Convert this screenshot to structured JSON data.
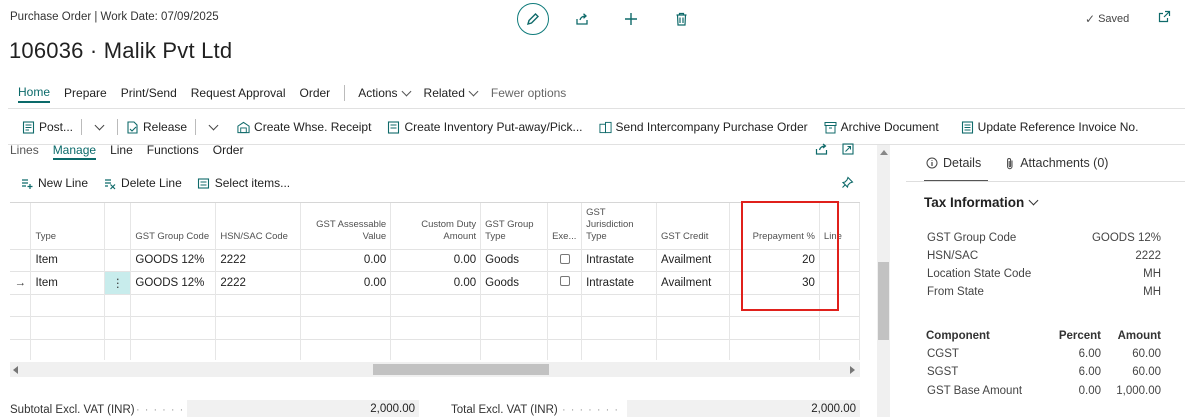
{
  "header": {
    "breadcrumb": "Purchase Order | Work Date: 07/09/2025",
    "title": "106036 · Malik Pvt Ltd",
    "saved_label": "Saved"
  },
  "actionbar": {
    "home": "Home",
    "prepare": "Prepare",
    "print_send": "Print/Send",
    "request_approval": "Request Approval",
    "order": "Order",
    "actions": "Actions",
    "related": "Related",
    "fewer_options": "Fewer options"
  },
  "commandbar": {
    "post": "Post...",
    "release": "Release",
    "create_whse_receipt": "Create Whse. Receipt",
    "create_inventory_putaway": "Create Inventory Put-away/Pick...",
    "send_intercompany": "Send Intercompany Purchase Order",
    "archive_document": "Archive Document",
    "update_reference_invoice": "Update Reference Invoice No."
  },
  "lines": {
    "label": "Lines",
    "tabs": {
      "manage": "Manage",
      "line": "Line",
      "functions": "Functions",
      "order": "Order"
    },
    "commands": {
      "new_line": "New Line",
      "delete_line": "Delete Line",
      "select_items": "Select items..."
    },
    "columns": {
      "type": "Type",
      "gst_group_code": "GST Group Code",
      "hsn_sac_code": "HSN/SAC Code",
      "gst_assessable_value": "GST Assessable Value",
      "custom_duty_amount": "Custom Duty Amount",
      "gst_group_type": "GST Group Type",
      "exempted": "Exe...",
      "gst_jurisdiction_type": "GST Jurisdiction Type",
      "gst_credit": "GST Credit",
      "prepayment_pct": "Prepayment %",
      "line": "Line"
    },
    "rows": [
      {
        "type": "Item",
        "gst_group_code": "GOODS 12%",
        "hsn_sac_code": "2222",
        "gst_assessable_value": "0.00",
        "custom_duty_amount": "0.00",
        "gst_group_type": "Goods",
        "jurisdiction": "Intrastate",
        "gst_credit": "Availment",
        "prepayment_pct": "20"
      },
      {
        "type": "Item",
        "gst_group_code": "GOODS 12%",
        "hsn_sac_code": "2222",
        "gst_assessable_value": "0.00",
        "custom_duty_amount": "0.00",
        "gst_group_type": "Goods",
        "jurisdiction": "Intrastate",
        "gst_credit": "Availment",
        "prepayment_pct": "30"
      }
    ]
  },
  "totals": {
    "subtotal_label": "Subtotal Excl. VAT (INR)",
    "subtotal_value": "2,000.00",
    "total_label": "Total Excl. VAT (INR)",
    "total_value": "2,000.00"
  },
  "factbox": {
    "tabs": {
      "details": "Details",
      "attachments": "Attachments (0)"
    },
    "section_title": "Tax Information",
    "fields": [
      {
        "label": "GST Group Code",
        "value": "GOODS 12%"
      },
      {
        "label": "HSN/SAC",
        "value": "2222"
      },
      {
        "label": "Location State Code",
        "value": "MH"
      },
      {
        "label": "From State",
        "value": "MH"
      }
    ],
    "components_header": {
      "component": "Component",
      "percent": "Percent",
      "amount": "Amount"
    },
    "components": [
      {
        "component": "CGST",
        "percent": "6.00",
        "amount": "60.00"
      },
      {
        "component": "SGST",
        "percent": "6.00",
        "amount": "60.00"
      },
      {
        "component": "GST Base Amount",
        "percent": "0.00",
        "amount": "1,000.00"
      }
    ]
  },
  "colors": {
    "accent": "#0b6a6a",
    "highlight": "#e0201b",
    "selected_cell": "#c8ecec"
  }
}
